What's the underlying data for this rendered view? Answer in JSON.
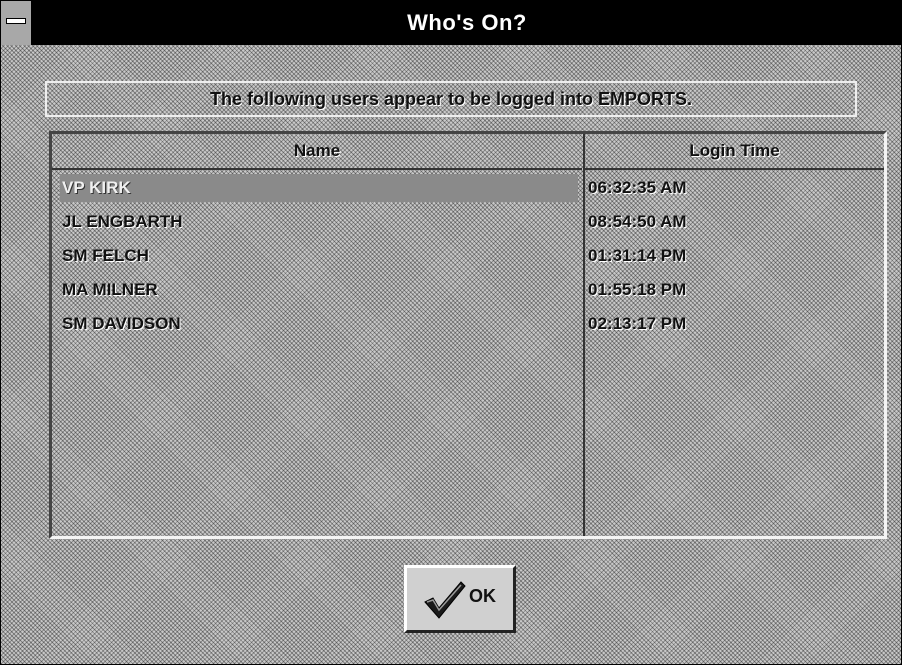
{
  "window": {
    "title": "Who's On?"
  },
  "message": "The following users appear to be logged into EMPORTS.",
  "table": {
    "columns": [
      "Name",
      "Login Time"
    ],
    "rows": [
      {
        "name": "VP KIRK",
        "time": "06:32:35 AM",
        "selected": true
      },
      {
        "name": "JL ENGBARTH",
        "time": "08:54:50 AM",
        "selected": false
      },
      {
        "name": "SM FELCH",
        "time": "01:31:14 PM",
        "selected": false
      },
      {
        "name": "MA MILNER",
        "time": "01:55:18 PM",
        "selected": false
      },
      {
        "name": "SM DAVIDSON",
        "time": "02:13:17 PM",
        "selected": false
      }
    ]
  },
  "buttons": {
    "ok_label": "OK",
    "ok_icon": "checkmark-icon"
  },
  "colors": {
    "titlebar": "#000000",
    "selection": "#8a8a8a"
  }
}
